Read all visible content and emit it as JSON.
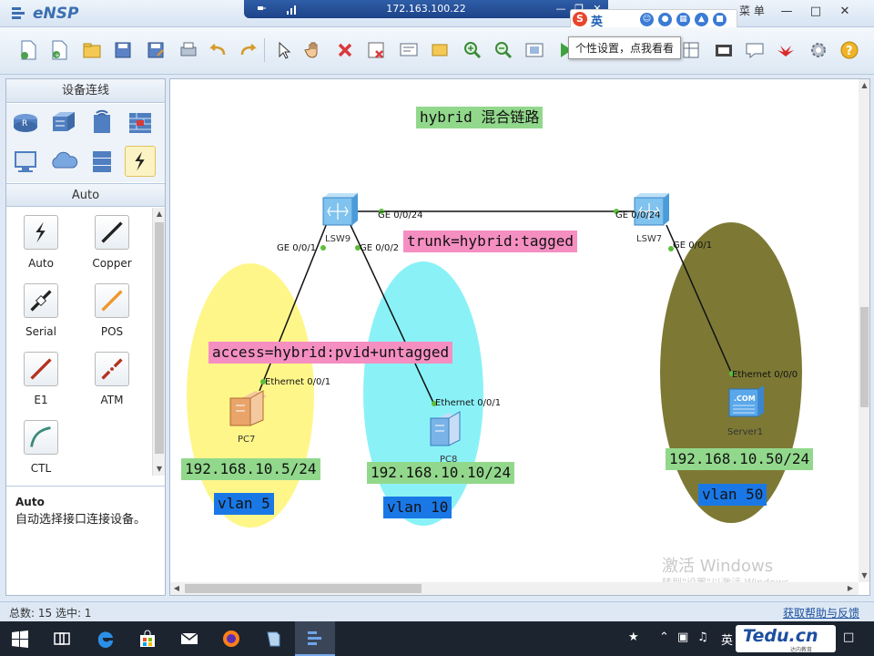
{
  "window": {
    "app_name": "eNSP",
    "remote_ip": "172.163.100.22",
    "tooltip": "个性设置，点我看看",
    "ime_lang": "英",
    "ime_menu": "菜 单"
  },
  "left_panel": {
    "title": "设备连线",
    "section_title": "Auto",
    "cables": [
      {
        "label": "Auto"
      },
      {
        "label": "Copper"
      },
      {
        "label": "Serial"
      },
      {
        "label": "POS"
      },
      {
        "label": "E1"
      },
      {
        "label": "ATM"
      },
      {
        "label": "CTL"
      }
    ],
    "description_title": "Auto",
    "description_text": "自动选择接口连接设备。"
  },
  "canvas": {
    "title": "hybrid 混合链路",
    "trunk_note": "trunk=hybrid:tagged",
    "access_note": "access=hybrid:pvid+untagged",
    "devices": {
      "lsw9": "LSW9",
      "lsw7": "LSW7",
      "pc7": "PC7",
      "pc8": "PC8",
      "server1": "Server1"
    },
    "ports": {
      "lsw9_ge24": "GE 0/0/24",
      "lsw7_ge24": "GE 0/0/24",
      "lsw9_ge1": "GE 0/0/1",
      "lsw9_ge2": "GE 0/0/2",
      "lsw7_ge1": "GE 0/0/1",
      "pc7_eth": "Ethernet 0/0/1",
      "pc8_eth": "Ethernet 0/0/1",
      "server_eth": "Ethernet 0/0/0"
    },
    "ips": {
      "pc7": "192.168.10.5/24",
      "pc8": "192.168.10.10/24",
      "server1": "192.168.10.50/24"
    },
    "vlans": {
      "pc7": "vlan 5",
      "pc8": "vlan 10",
      "server1": "vlan 50"
    },
    "watermark": "激活 Windows",
    "watermark_sub": "转到\"设置\"以激活 Windows。",
    "colors": {
      "vlan5_zone": "#fff68a",
      "vlan10_zone": "#8af2f7",
      "vlan50_zone": "#7d7935"
    }
  },
  "statusbar": {
    "left": "总数: 15  选中: 1",
    "right": "获取帮助与反馈"
  },
  "taskbar": {
    "tray_ime": "英",
    "logo_main": "Tedu.cn",
    "logo_sub": "达内教育"
  }
}
